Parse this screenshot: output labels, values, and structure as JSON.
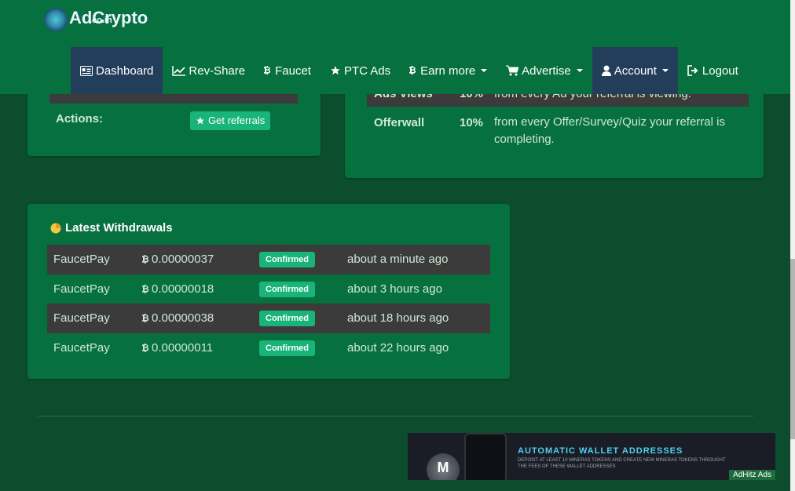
{
  "brand": {
    "name": "AdCrypto",
    "domain": ".co.in"
  },
  "nav": [
    {
      "label": "Dashboard",
      "icon": "id-card-icon"
    },
    {
      "label": "Rev-Share",
      "icon": "line-chart-icon"
    },
    {
      "label": "Faucet",
      "icon": "bitcoin-icon"
    },
    {
      "label": "PTC Ads",
      "icon": "star-icon"
    },
    {
      "label": "Earn more",
      "icon": "bitcoin-icon"
    },
    {
      "label": "Advertise",
      "icon": "cart-icon"
    },
    {
      "label": "Account",
      "icon": "user-icon"
    },
    {
      "label": "Logout",
      "icon": "sign-out-icon"
    }
  ],
  "referrals": {
    "actions_label": "Actions:",
    "get_referrals_label": "Get referrals"
  },
  "revshare": [
    {
      "name": "Ads Views",
      "percent": "10%",
      "description": "from every Ad your referral is viewing."
    },
    {
      "name": "Offerwall",
      "percent": "10%",
      "description": "from every Offer/Survey/Quiz your referral is completing."
    }
  ],
  "withdrawals": {
    "title": "Latest Withdrawals",
    "rows": [
      {
        "method": "FaucetPay",
        "amount": "0.00000037",
        "status": "Confirmed",
        "time": "about a minute ago"
      },
      {
        "method": "FaucetPay",
        "amount": "0.00000018",
        "status": "Confirmed",
        "time": "about 3 hours ago"
      },
      {
        "method": "FaucetPay",
        "amount": "0.00000038",
        "status": "Confirmed",
        "time": "about 18 hours ago"
      },
      {
        "method": "FaucetPay",
        "amount": "0.00000011",
        "status": "Confirmed",
        "time": "about 22 hours ago"
      }
    ]
  },
  "ad": {
    "title": "AUTOMATIC WALLET ADDRESSES",
    "subtitle": "DEPOSIT AT LEAST 10 MINERAS TOKENS AND CREATE NEW MINERAS TOKENS THROUGHT THE FEES OF THESE WALLET ADDRESSES",
    "badge": "AdHitz Ads",
    "coin_letter": "M"
  },
  "colors": {
    "header": "#07703f",
    "active_nav": "#233e5a",
    "accent": "#18b47a",
    "page_bg": "#0b4d2c"
  }
}
